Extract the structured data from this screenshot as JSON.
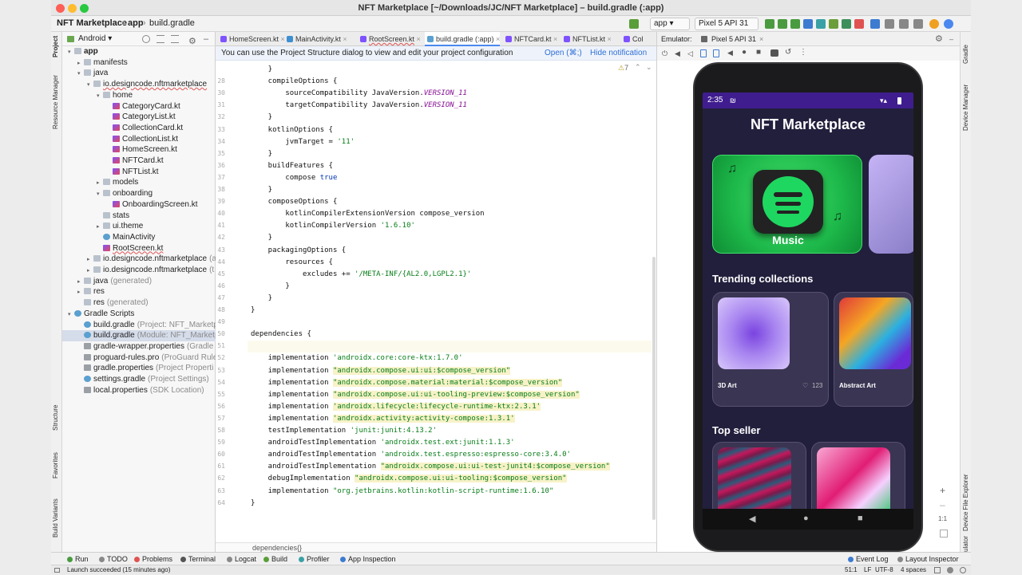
{
  "window": {
    "title": "NFT Marketplace [~/Downloads/JC/NFT Marketplace] – build.gradle (:app)"
  },
  "nav": {
    "project": "NFT Marketplace",
    "module": "app",
    "file": "build.gradle",
    "run_config": "app",
    "device": "Pixel 5 API 31"
  },
  "left_strip": {
    "project": "Project",
    "resource_manager": "Resource Manager",
    "structure": "Structure",
    "favorites": "Favorites",
    "build_variants": "Build Variants"
  },
  "right_strip": {
    "gradle": "Gradle",
    "device_manager": "Device Manager",
    "device_file_explorer": "Device File Explorer",
    "emulator": "Emulator"
  },
  "project_panel": {
    "view": "Android",
    "tree": [
      {
        "label": "app",
        "bold": true,
        "icon": "folder",
        "arrow": "▾"
      },
      {
        "label": "manifests",
        "icon": "folder",
        "arrow": "▸"
      },
      {
        "label": "java",
        "icon": "folder",
        "arrow": "▾"
      },
      {
        "label": "io.designcode.nftmarketplace",
        "icon": "pkg",
        "arrow": "▾",
        "underline": true
      },
      {
        "label": "home",
        "icon": "pkg",
        "arrow": "▾"
      },
      {
        "label": "CategoryCard.kt",
        "icon": "kt"
      },
      {
        "label": "CategoryList.kt",
        "icon": "kt"
      },
      {
        "label": "CollectionCard.kt",
        "icon": "kt"
      },
      {
        "label": "CollectionList.kt",
        "icon": "kt"
      },
      {
        "label": "HomeScreen.kt",
        "icon": "kt"
      },
      {
        "label": "NFTCard.kt",
        "icon": "kt"
      },
      {
        "label": "NFTList.kt",
        "icon": "kt"
      },
      {
        "label": "models",
        "icon": "pkg",
        "arrow": "▸"
      },
      {
        "label": "onboarding",
        "icon": "pkg",
        "arrow": "▾"
      },
      {
        "label": "OnboardingScreen.kt",
        "icon": "kt"
      },
      {
        "label": "stats",
        "icon": "pkg"
      },
      {
        "label": "ui.theme",
        "icon": "pkg",
        "arrow": "▸"
      },
      {
        "label": "MainActivity",
        "icon": "grad"
      },
      {
        "label": "RootScreen.kt",
        "icon": "kt",
        "underline": true
      },
      {
        "label": "io.designcode.nftmarketplace",
        "suffix": "(a",
        "icon": "pkg",
        "arrow": "▸"
      },
      {
        "label": "io.designcode.nftmarketplace",
        "suffix": "(t",
        "icon": "pkg",
        "arrow": "▸"
      },
      {
        "label": "java",
        "suffix": "(generated)",
        "icon": "folder",
        "arrow": "▸"
      },
      {
        "label": "res",
        "icon": "folder",
        "arrow": "▸"
      },
      {
        "label": "res",
        "suffix": "(generated)",
        "icon": "folder"
      },
      {
        "label": "Gradle Scripts",
        "icon": "grad",
        "arrow": "▾"
      },
      {
        "label": "build.gradle",
        "suffix": "(Project: NFT_Marketp",
        "icon": "grad"
      },
      {
        "label": "build.gradle",
        "suffix": "(Module: NFT_Marketp",
        "icon": "grad",
        "selected": true
      },
      {
        "label": "gradle-wrapper.properties",
        "suffix": "(Gradle",
        "icon": "prop"
      },
      {
        "label": "proguard-rules.pro",
        "suffix": "(ProGuard Rule:",
        "icon": "prop"
      },
      {
        "label": "gradle.properties",
        "suffix": "(Project Properti",
        "icon": "prop"
      },
      {
        "label": "settings.gradle",
        "suffix": "(Project Settings)",
        "icon": "grad"
      },
      {
        "label": "local.properties",
        "suffix": "(SDK Location)",
        "icon": "prop"
      }
    ]
  },
  "tabs": [
    {
      "label": "HomeScreen.kt",
      "color": "#7f52ff"
    },
    {
      "label": "MainActivity.kt",
      "color": "#3d8fd0"
    },
    {
      "label": "RootScreen.kt",
      "color": "#7f52ff"
    },
    {
      "label": "build.gradle (:app)",
      "color": "#5aa0d0",
      "active": true
    },
    {
      "label": "NFTCard.kt",
      "color": "#7f52ff"
    },
    {
      "label": "NFTList.kt",
      "color": "#7f52ff"
    },
    {
      "label": "Col",
      "color": "#7f52ff"
    }
  ],
  "notice": {
    "text": "You can use the Project Structure dialog to view and edit your project configuration",
    "open": "Open (⌘;)",
    "hide": "Hide notification",
    "warnings": "7"
  },
  "code": [
    {
      "n": "",
      "t": "    }"
    },
    {
      "n": "28",
      "t": "    compileOptions {"
    },
    {
      "n": "30",
      "t": "        sourceCompatibility JavaVersion.",
      "it": "VERSION_11"
    },
    {
      "n": "31",
      "t": "        targetCompatibility JavaVersion.",
      "it": "VERSION_11"
    },
    {
      "n": "32",
      "t": "    }"
    },
    {
      "n": "33",
      "t": "    kotlinOptions {"
    },
    {
      "n": "34",
      "t": "        jvmTarget = ",
      "s": "'11'"
    },
    {
      "n": "35",
      "t": "    }"
    },
    {
      "n": "36",
      "t": "    buildFeatures {"
    },
    {
      "n": "37",
      "t": "        compose ",
      "k": "true"
    },
    {
      "n": "38",
      "t": "    }"
    },
    {
      "n": "39",
      "t": "    composeOptions {"
    },
    {
      "n": "40",
      "t": "        kotlinCompilerExtensionVersion compose_version"
    },
    {
      "n": "41",
      "t": "        kotlinCompilerVersion ",
      "s": "'1.6.10'"
    },
    {
      "n": "42",
      "t": "    }"
    },
    {
      "n": "43",
      "t": "    packagingOptions {"
    },
    {
      "n": "44",
      "t": "        resources {"
    },
    {
      "n": "45",
      "t": "            excludes += ",
      "s": "'/META-INF/{AL2.0,LGPL2.1}'"
    },
    {
      "n": "46",
      "t": "        }"
    },
    {
      "n": "47",
      "t": "    }"
    },
    {
      "n": "48",
      "t": "}"
    },
    {
      "n": "49",
      "t": ""
    },
    {
      "n": "50",
      "t": "dependencies {"
    },
    {
      "n": "51",
      "t": "",
      "cur": true
    },
    {
      "n": "52",
      "t": "    implementation ",
      "s": "'androidx.core:core-ktx:1.7.0'"
    },
    {
      "n": "53",
      "t": "    implementation ",
      "s": "\"androidx.compose.ui:ui:$compose_version\"",
      "hl": true
    },
    {
      "n": "54",
      "t": "    implementation ",
      "s": "\"androidx.compose.material:material:$compose_version\"",
      "hl": true
    },
    {
      "n": "55",
      "t": "    implementation ",
      "s": "\"androidx.compose.ui:ui-tooling-preview:$compose_version\"",
      "hl": true
    },
    {
      "n": "56",
      "t": "    implementation ",
      "s": "'androidx.lifecycle:lifecycle-runtime-ktx:2.3.1'",
      "hl": true
    },
    {
      "n": "57",
      "t": "    implementation ",
      "s": "'androidx.activity:activity-compose:1.3.1'",
      "hl": true
    },
    {
      "n": "58",
      "t": "    testImplementation ",
      "s": "'junit:junit:4.13.2'"
    },
    {
      "n": "59",
      "t": "    androidTestImplementation ",
      "s": "'androidx.test.ext:junit:1.1.3'"
    },
    {
      "n": "60",
      "t": "    androidTestImplementation ",
      "s": "'androidx.test.espresso:espresso-core:3.4.0'"
    },
    {
      "n": "61",
      "t": "    androidTestImplementation ",
      "s": "\"androidx.compose.ui:ui-test-junit4:$compose_version\"",
      "hl": true
    },
    {
      "n": "62",
      "t": "    debugImplementation ",
      "s": "\"androidx.compose.ui:ui-tooling:$compose_version\"",
      "hl": true
    },
    {
      "n": "63",
      "t": "    implementation ",
      "s": "\"org.jetbrains.kotlin:kotlin-script-runtime:1.6.10\""
    },
    {
      "n": "64",
      "t": "}"
    }
  ],
  "breadcrumb": "dependencies{}",
  "emulator": {
    "label": "Emulator:",
    "device": "Pixel 5 API 31",
    "zoom": "1:1"
  },
  "phone": {
    "time": "2:35",
    "app_title": "NFT Marketplace",
    "category": "Music",
    "trending_title": "Trending collections",
    "collections": [
      {
        "name": "3D Art",
        "likes": "123"
      },
      {
        "name": "Abstract Art"
      }
    ],
    "top_seller": "Top seller"
  },
  "toolwindows": [
    "Run",
    "TODO",
    "Problems",
    "Terminal",
    "Logcat",
    "Build",
    "Profiler",
    "App Inspection"
  ],
  "toolwindows_right": [
    "Event Log",
    "Layout Inspector"
  ],
  "status": {
    "message": "Launch succeeded (15 minutes ago)",
    "position": "51:1",
    "eol": "LF",
    "encoding": "UTF-8",
    "indent": "4 spaces"
  }
}
